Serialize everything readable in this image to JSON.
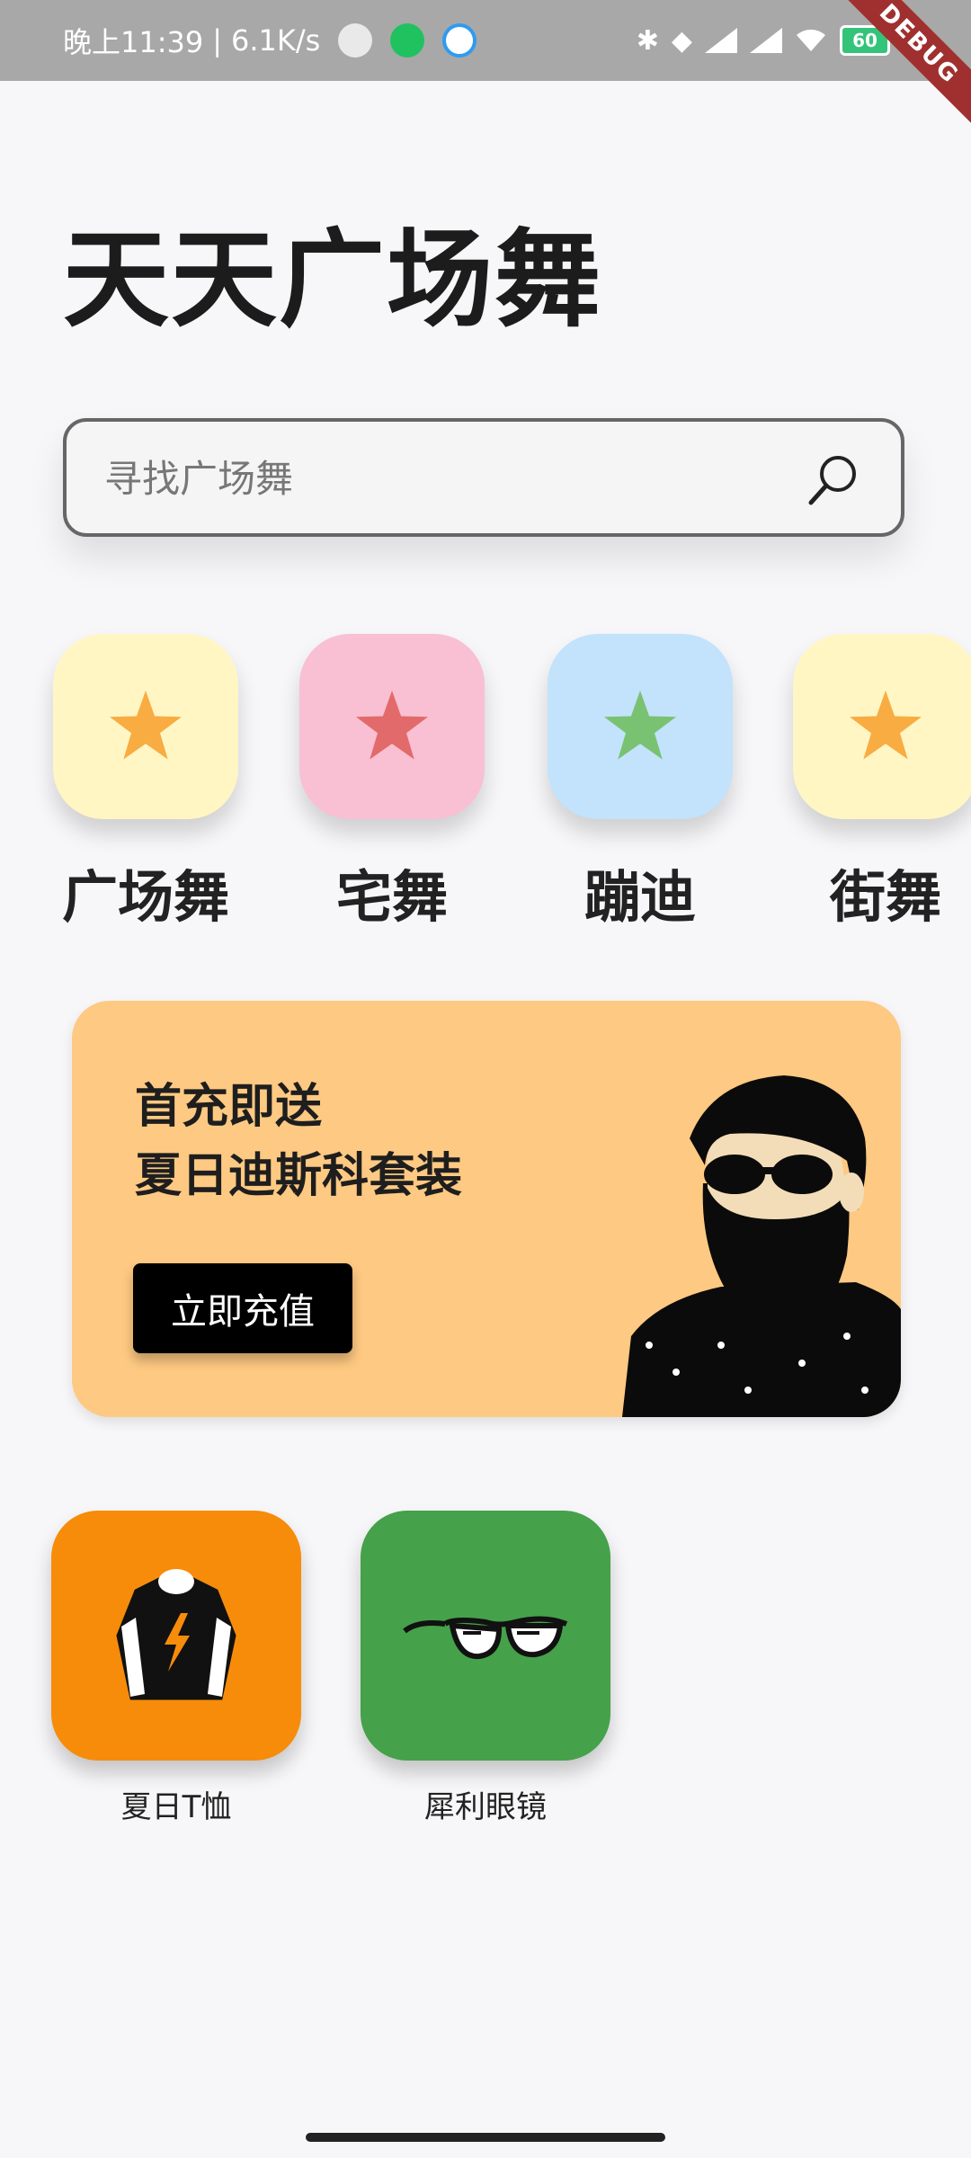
{
  "status_bar": {
    "time": "晚上11:39",
    "separator": "|",
    "net_speed": "6.1K/s",
    "battery": "60",
    "debug_banner": "DEBUG"
  },
  "app": {
    "title": "天天广场舞"
  },
  "search": {
    "placeholder": "寻找广场舞",
    "icon": "search-icon"
  },
  "categories": [
    {
      "label": "广场舞",
      "tile_color": "#fff6c4",
      "star_color": "#f8ac42"
    },
    {
      "label": "宅舞",
      "tile_color": "#f8c0d2",
      "star_color": "#e36a6a"
    },
    {
      "label": "蹦迪",
      "tile_color": "#c3e2fb",
      "star_color": "#78c272"
    },
    {
      "label": "街舞",
      "tile_color": "#fff6c4",
      "star_color": "#f8ac42"
    }
  ],
  "promo": {
    "line1": "首充即送",
    "line2": "夏日迪斯科套装",
    "button": "立即充值",
    "background": "#fec982",
    "figure": "bearded-man-illustration"
  },
  "products": [
    {
      "label": "夏日T恤",
      "tile_color": "#f78c0a",
      "icon": "tshirt-icon"
    },
    {
      "label": "犀利眼镜",
      "tile_color": "#45a14a",
      "icon": "sunglasses-icon"
    }
  ]
}
